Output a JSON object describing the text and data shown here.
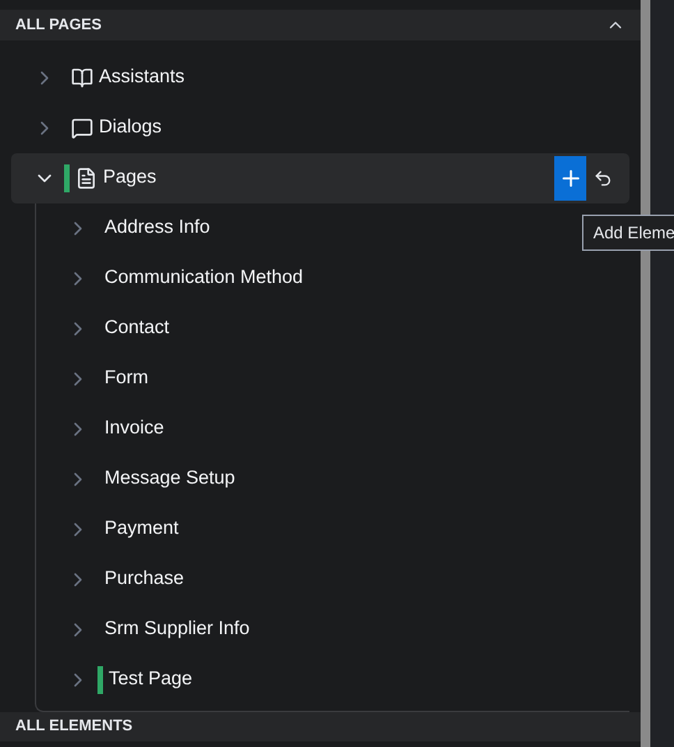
{
  "section": {
    "title": "ALL PAGES",
    "expanded": true
  },
  "tree": [
    {
      "label": "Assistants",
      "expanded": false,
      "selected": false,
      "modified": false
    },
    {
      "label": "Dialogs",
      "expanded": false,
      "selected": false,
      "modified": false
    },
    {
      "label": "Pages",
      "expanded": true,
      "selected": true,
      "modified": true,
      "children": [
        {
          "label": "Address Info",
          "expanded": false,
          "selected": false,
          "modified": false
        },
        {
          "label": "Communication Method",
          "expanded": false,
          "selected": false,
          "modified": false
        },
        {
          "label": "Contact",
          "expanded": false,
          "selected": false,
          "modified": false
        },
        {
          "label": "Form",
          "expanded": false,
          "selected": false,
          "modified": false
        },
        {
          "label": "Invoice",
          "expanded": false,
          "selected": false,
          "modified": false
        },
        {
          "label": "Message Setup",
          "expanded": false,
          "selected": false,
          "modified": false
        },
        {
          "label": "Payment",
          "expanded": false,
          "selected": false,
          "modified": false
        },
        {
          "label": "Purchase",
          "expanded": false,
          "selected": false,
          "modified": false
        },
        {
          "label": "Srm Supplier Info",
          "expanded": false,
          "selected": false,
          "modified": false
        },
        {
          "label": "Test Page",
          "expanded": false,
          "selected": false,
          "modified": true
        }
      ]
    }
  ],
  "tooltip": "Add Eleme",
  "next_section": {
    "title": "ALL ELEMENTS"
  }
}
